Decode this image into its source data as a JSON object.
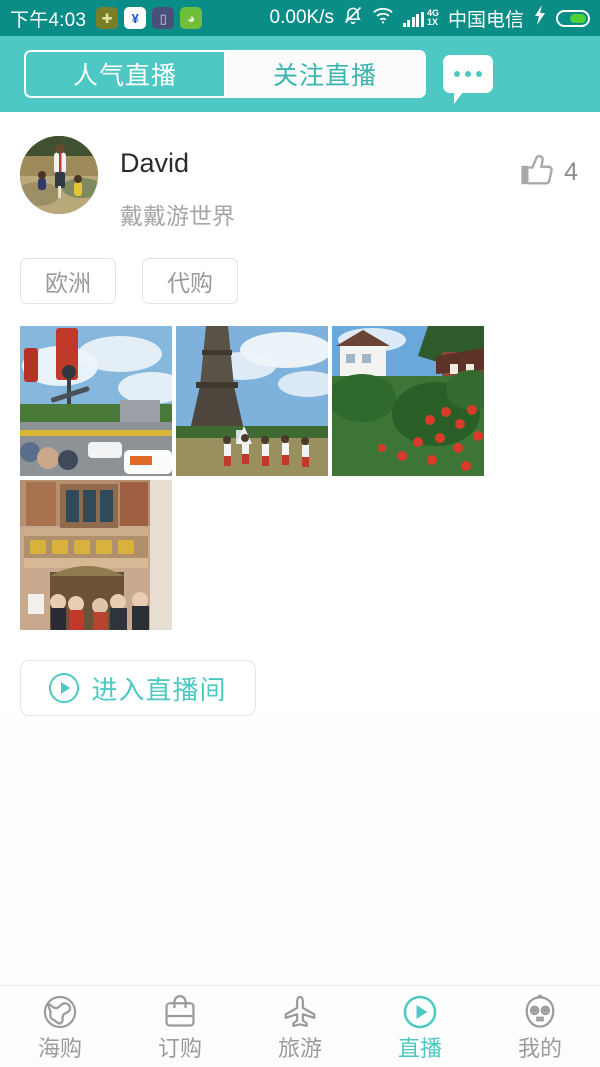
{
  "statusbar": {
    "time": "下午4:03",
    "app_icons": [
      {
        "name": "security-shield-icon",
        "glyph": "⊕"
      },
      {
        "name": "antivirus-shield-icon",
        "glyph": "$"
      },
      {
        "name": "phone-manager-icon",
        "glyph": "▯"
      },
      {
        "name": "android-app-icon",
        "glyph": "◑"
      }
    ],
    "network_speed": "0.00K/s",
    "mute_icon": "bell-muted-icon",
    "wifi_icon": "wifi-icon",
    "signal_label_top": "4G",
    "signal_label_bottom": "1X",
    "carrier": "中国电信",
    "charging_icon": "lightning-bolt-icon",
    "battery_icon": "battery-icon"
  },
  "header": {
    "tabs": [
      {
        "label": "人气直播",
        "active": true
      },
      {
        "label": "关注直播",
        "active": false
      }
    ],
    "chat_icon": "chat-bubble-icon",
    "bg_color": "#4ec8c2"
  },
  "post": {
    "avatar_name": "user-avatar",
    "username": "David",
    "subtitle": "戴戴游世界",
    "like_icon": "thumbs-up-icon",
    "like_count": "4",
    "tags": [
      "欧洲",
      "代购"
    ],
    "photos": [
      {
        "alt": "巴黎街道红色旗帜"
      },
      {
        "alt": "埃菲尔铁塔"
      },
      {
        "alt": "山村花园红花"
      },
      {
        "alt": "历史建筑合影"
      }
    ],
    "enter_button": {
      "label": "进入直播间",
      "icon": "play-circle-icon"
    }
  },
  "tabbar": {
    "items": [
      {
        "label": "海购",
        "icon": "globe-icon",
        "active": false
      },
      {
        "label": "订购",
        "icon": "shopping-bag-icon",
        "active": false
      },
      {
        "label": "旅游",
        "icon": "airplane-icon",
        "active": false
      },
      {
        "label": "直播",
        "icon": "play-circle-icon",
        "active": true
      },
      {
        "label": "我的",
        "icon": "profile-face-icon",
        "active": false
      }
    ],
    "active_color": "#4ec8c2",
    "inactive_color": "#9b9b9b"
  }
}
